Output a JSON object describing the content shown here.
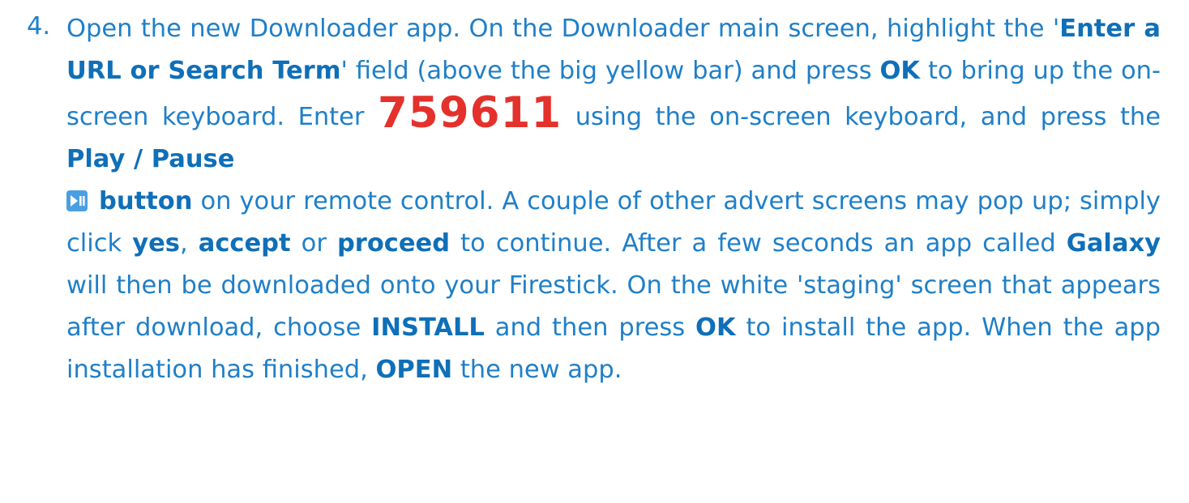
{
  "step": {
    "number": "4.",
    "t1": "Open the new Downloader app. On the Downloader main screen, highlight the '",
    "h1": "Enter a URL or Search Term",
    "t2": "' field (above the big yellow bar) and press ",
    "h2": "OK",
    "t3": " to bring up the on-screen keyboard. Enter ",
    "code": "759611",
    "t4": " using the on-screen keyboard, and press the ",
    "h3": "Play / Pause",
    "icon": "play-pause-icon",
    "h4": "button",
    "t5": " on your remote control. A couple of other advert screens may pop up; simply click ",
    "h5": "yes",
    "t6": ", ",
    "h6": "accept",
    "t7": " or ",
    "h7": "proceed",
    "t8": " to continue. After a few seconds an app called ",
    "h8": "Galaxy",
    "t9": " will then be downloaded onto your Firestick. On the white 'staging' screen that appears after download, choose ",
    "h9": "INSTALL",
    "t10": " and then press ",
    "h10": "OK",
    "t11": " to install the app. When the app installation has finished, ",
    "h11": "OPEN",
    "t12": " the new app."
  },
  "colors": {
    "text": "#1f7fc8",
    "highlight": "#0f6fb8",
    "code": "#e4312b",
    "icon_bg": "#4a9fe3"
  }
}
